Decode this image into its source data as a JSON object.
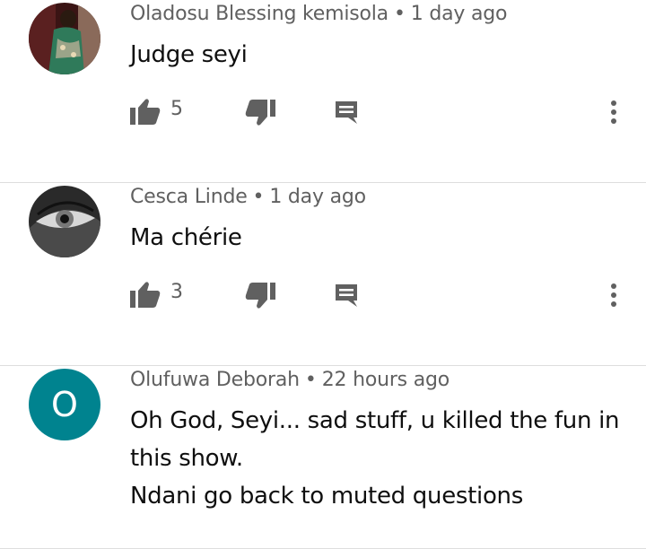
{
  "comments": [
    {
      "author": "Oladosu Blessing kemisola",
      "separator": "•",
      "time": "1 day ago",
      "text": "Judge seyi",
      "likes": "5",
      "avatar": {
        "kind": "photo",
        "icon": "person-photo",
        "colors": [
          "#4a1c1c",
          "#2f7a5a",
          "#c9b79c"
        ]
      }
    },
    {
      "author": "Cesca Linde",
      "separator": "•",
      "time": "1 day ago",
      "text": "Ma chérie",
      "likes": "3",
      "avatar": {
        "kind": "photo",
        "icon": "eye-photo",
        "colors": [
          "#1a1a1a",
          "#777777",
          "#d8d8d8"
        ]
      }
    },
    {
      "author": "Olufuwa Deborah",
      "separator": "•",
      "time": "22 hours ago",
      "text_lines": [
        "Oh God, Seyi... sad stuff, u killed the fun in",
        "this show.",
        "Ndani go back to muted questions"
      ],
      "avatar": {
        "kind": "letter",
        "letter": "O",
        "color": "#00838f"
      }
    }
  ],
  "icons": {
    "like": "thumbs-up-icon",
    "dislike": "thumbs-down-icon",
    "reply": "comment-reply-icon",
    "menu": "more-vertical-icon"
  },
  "colors": {
    "icon": "#606060",
    "meta_text": "#606060",
    "divider": "#dedede"
  }
}
